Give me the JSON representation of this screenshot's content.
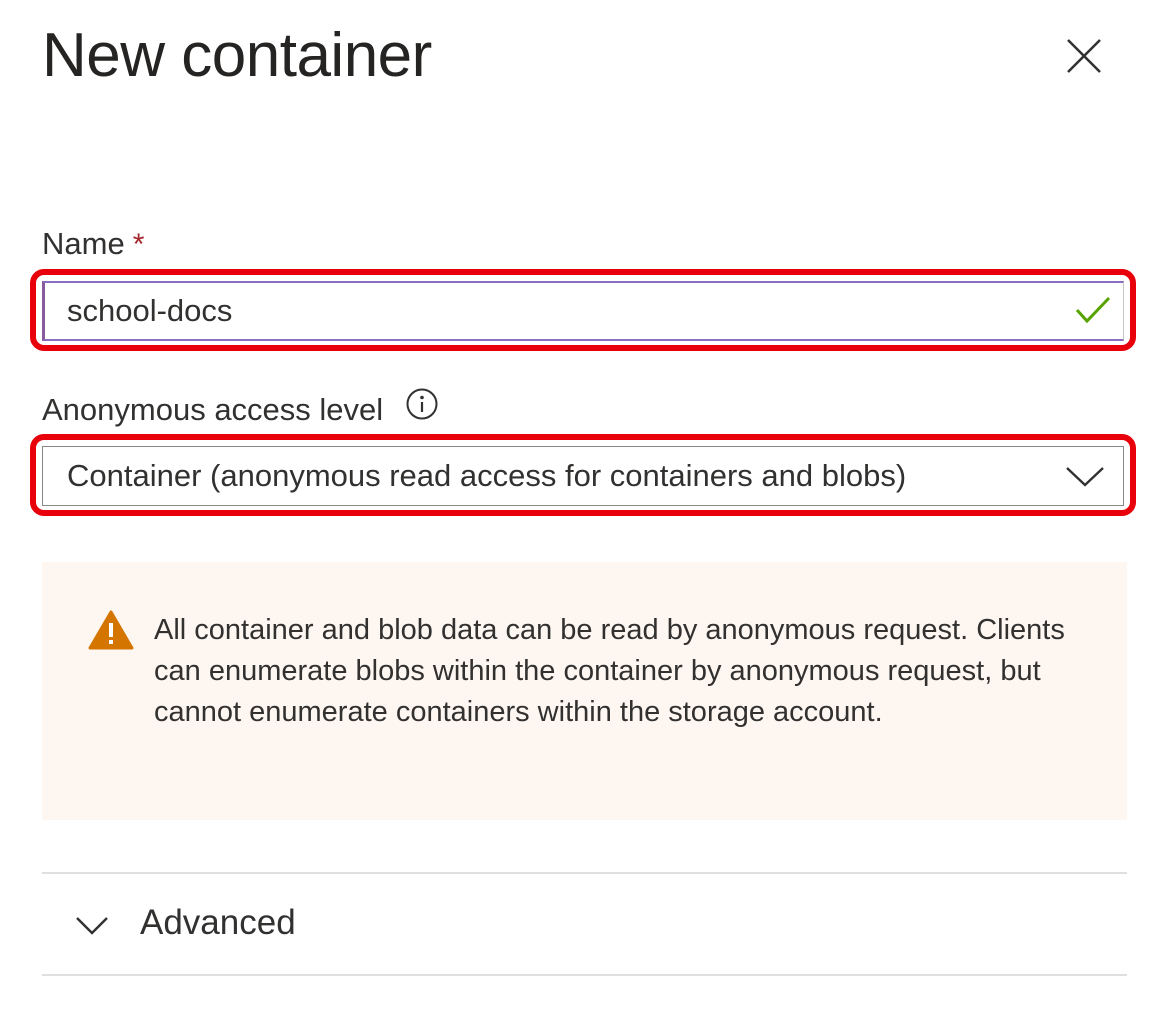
{
  "panel": {
    "title": "New container"
  },
  "name_field": {
    "label": "Name",
    "required_marker": "*",
    "value": "school-docs",
    "valid": true
  },
  "access_level": {
    "label": "Anonymous access level",
    "selected": "Container (anonymous read access for containers and blobs)"
  },
  "warning": {
    "text": "All container and blob data can be read by anonymous request. Clients can enumerate blobs within the container by anonymous request, but cannot enumerate containers within the storage account."
  },
  "advanced": {
    "label": "Advanced",
    "expanded": false
  },
  "colors": {
    "highlight": "#e8000b",
    "required": "#a4262c",
    "valid_check": "#57a300",
    "warning_icon": "#d47500",
    "warning_bg": "#fdf6f1"
  },
  "icons": {
    "close": "close-icon",
    "check": "checkmark-icon",
    "info": "info-icon",
    "dropdown": "chevron-down-icon",
    "warning": "warning-icon",
    "expand": "chevron-down-icon"
  }
}
